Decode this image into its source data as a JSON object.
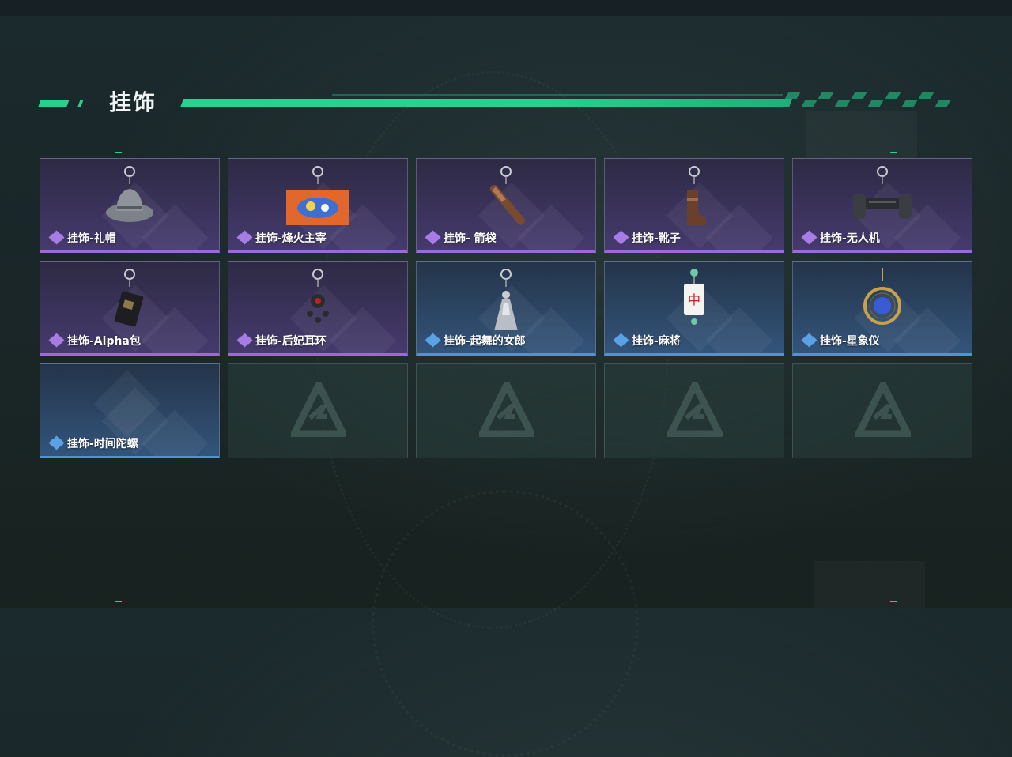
{
  "header": {
    "title": "挂饰"
  },
  "colors": {
    "accent": "#23d38f",
    "purple_rarity": "#9c6ad8",
    "blue_rarity": "#4f93d6"
  },
  "items": [
    {
      "label": "挂饰-礼帽",
      "rarity": "purple",
      "icon": "fedora-hat-icon"
    },
    {
      "label": "挂饰-烽火主宰",
      "rarity": "purple",
      "icon": "graffiti-card-icon"
    },
    {
      "label": "挂饰- 箭袋",
      "rarity": "purple",
      "icon": "quiver-icon"
    },
    {
      "label": "挂饰-靴子",
      "rarity": "purple",
      "icon": "boot-icon"
    },
    {
      "label": "挂饰-无人机",
      "rarity": "purple",
      "icon": "drone-icon"
    },
    {
      "label": "挂饰-Alpha包",
      "rarity": "purple",
      "icon": "alpha-pack-icon"
    },
    {
      "label": "挂饰-后妃耳环",
      "rarity": "purple",
      "icon": "earring-icon"
    },
    {
      "label": "挂饰-起舞的女郎",
      "rarity": "blue",
      "icon": "dancing-girl-icon"
    },
    {
      "label": "挂饰-麻将",
      "rarity": "blue",
      "icon": "mahjong-tile-icon"
    },
    {
      "label": "挂饰-星象仪",
      "rarity": "blue",
      "icon": "astrolabe-icon"
    },
    {
      "label": "挂饰-时间陀螺",
      "rarity": "blue",
      "icon": "none"
    }
  ],
  "empty_slots": 4,
  "empty_slot_icon": "game-logo-icon"
}
